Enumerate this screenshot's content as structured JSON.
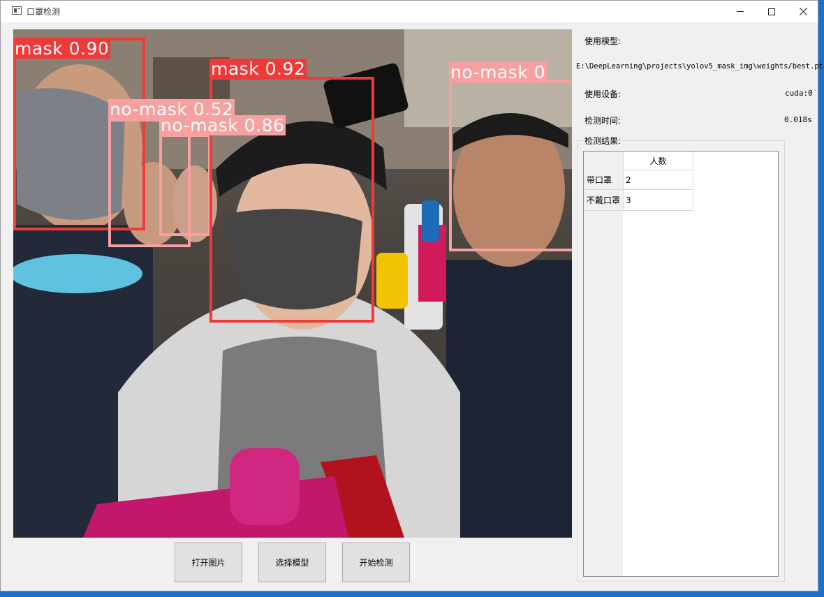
{
  "window": {
    "title": "口罩检测"
  },
  "image": {
    "detections": [
      {
        "label": "mask 0.90",
        "class": "mask",
        "color": "#f03a3a"
      },
      {
        "label": "mask 0.92",
        "class": "mask",
        "color": "#f03a3a"
      },
      {
        "label": "no-mask 0.52",
        "class": "no-mask",
        "color": "#f7a0a0"
      },
      {
        "label": "no-mask 0.86",
        "class": "no-mask",
        "color": "#f7a0a0"
      },
      {
        "label": "no-mask 0",
        "class": "no-mask",
        "color": "#f7a0a0"
      }
    ]
  },
  "buttons": {
    "open_image": "打开图片",
    "select_model": "选择模型",
    "start_detect": "开始检测"
  },
  "info": {
    "model_label": "使用模型:",
    "model_path": "E:\\DeepLearning\\projects\\yolov5_mask_img\\weights/best.pt",
    "device_label": "使用设备:",
    "device_value": "cuda:0",
    "time_label": "检测时间:",
    "time_value": "0.018s"
  },
  "results": {
    "group_title": "检测结果:",
    "column_header": "人数",
    "rows": [
      {
        "label": "带口罩",
        "count": "2"
      },
      {
        "label": "不戴口罩",
        "count": "3"
      }
    ]
  }
}
